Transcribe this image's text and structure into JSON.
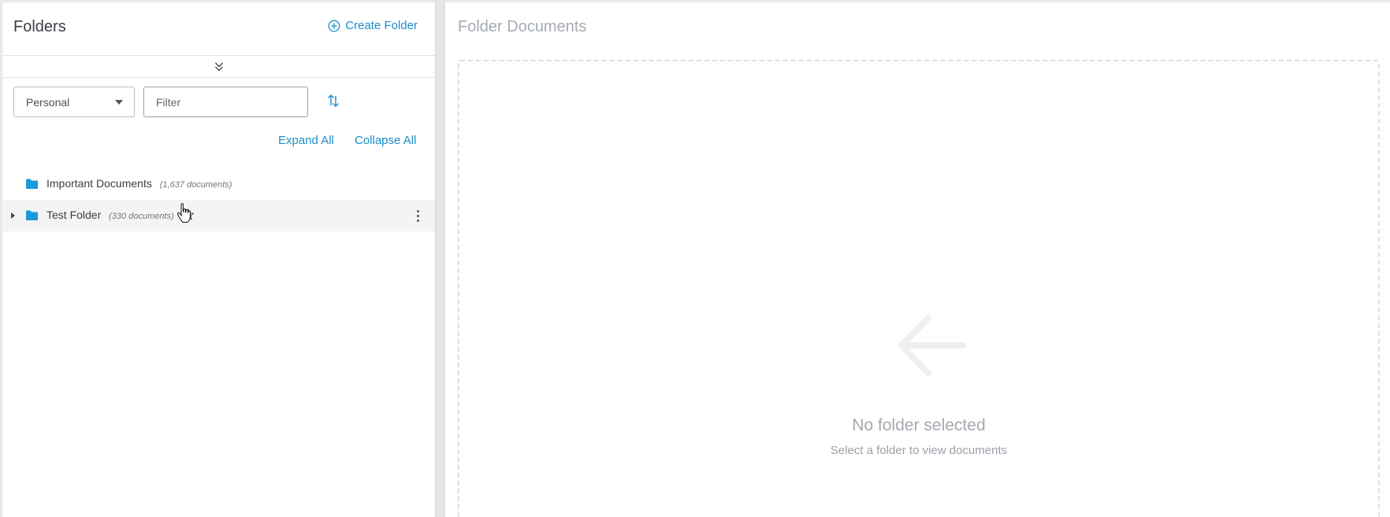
{
  "left_panel": {
    "title": "Folders",
    "create_folder_label": "Create Folder",
    "scope_select": {
      "selected": "Personal"
    },
    "filter_input": {
      "placeholder": "Filter",
      "value": ""
    },
    "expand_all_label": "Expand All",
    "collapse_all_label": "Collapse All",
    "folders": [
      {
        "name": "Important Documents",
        "count": "(1,637 documents)",
        "expandable": false
      },
      {
        "name": "Test Folder",
        "count": "(330 documents)",
        "expandable": true
      }
    ]
  },
  "right_panel": {
    "title": "Folder Documents",
    "empty_state": {
      "title": "No folder selected",
      "subtitle": "Select a folder to view documents"
    }
  },
  "colors": {
    "accent": "#1a8fc9",
    "folder_icon": "#1a9ad6",
    "muted_text": "#a5abb2"
  },
  "icons": {
    "create_folder": "plus-circle-icon",
    "collapse_toggle": "double-chevron-down-icon",
    "sort": "sort-arrows-icon",
    "folder": "folder-icon",
    "favorite": "star-outline-icon",
    "more": "kebab-menu-icon",
    "empty_state": "arrow-left-icon"
  }
}
